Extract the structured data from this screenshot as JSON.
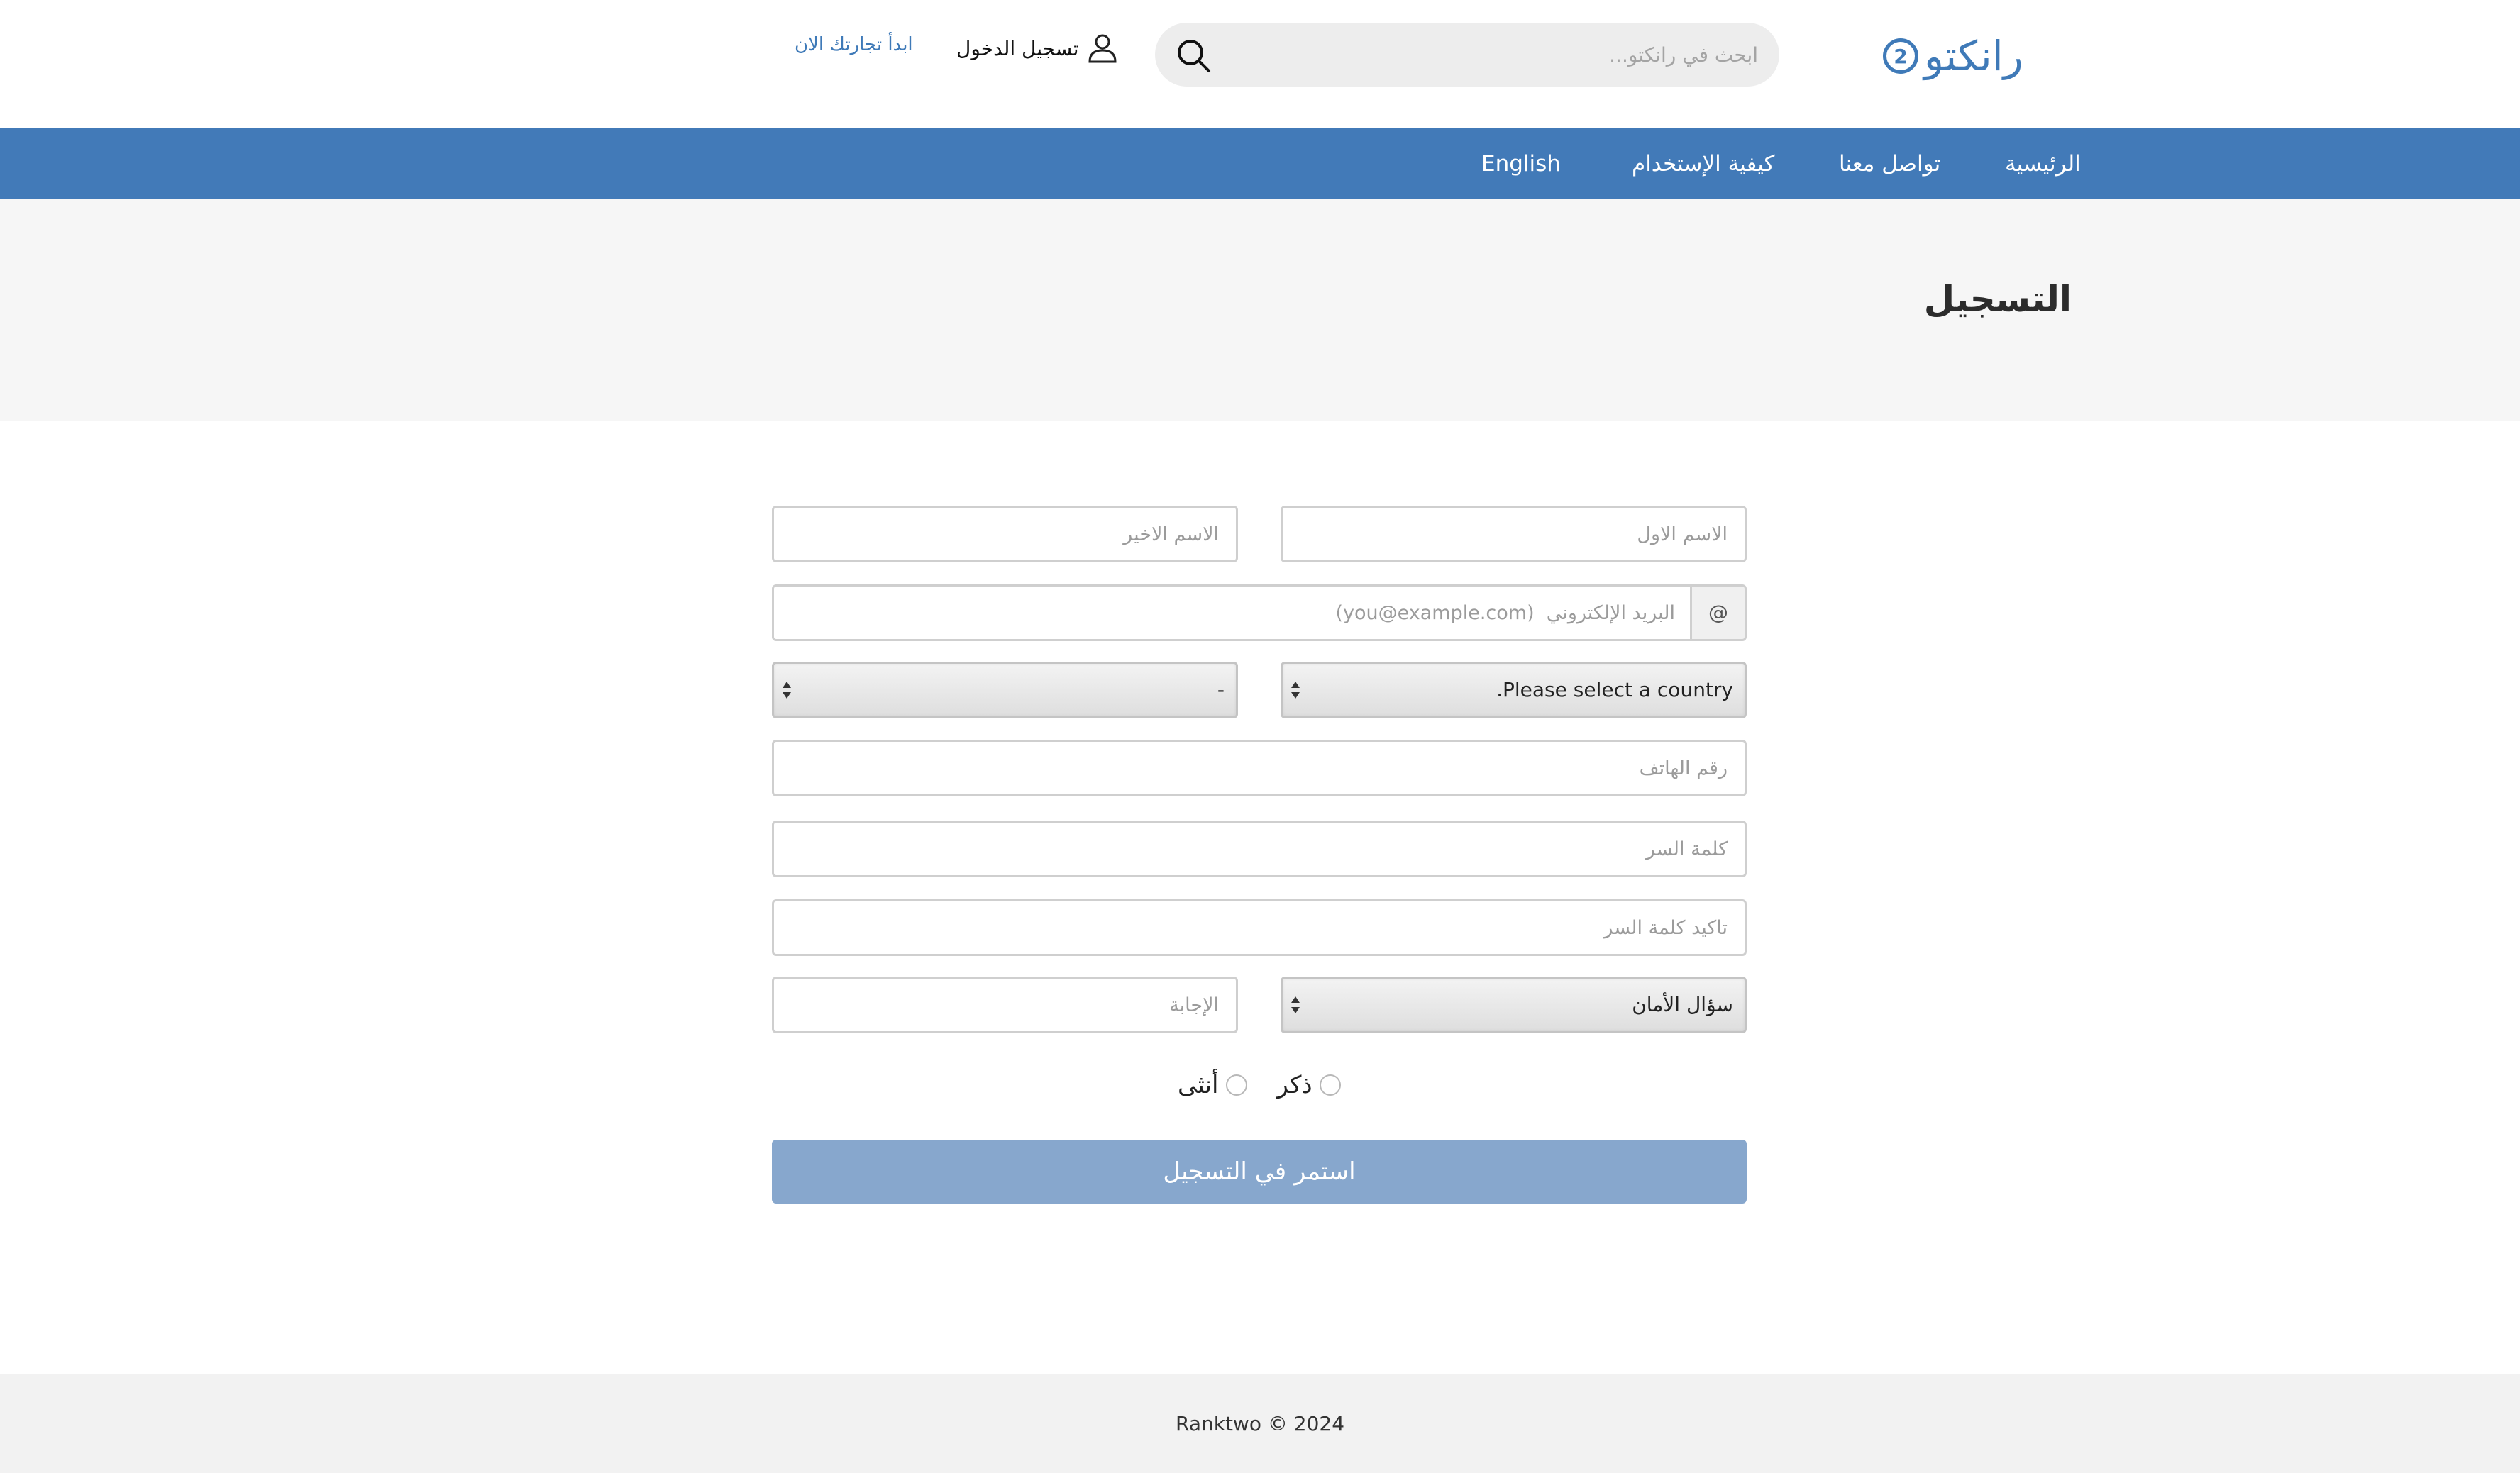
{
  "header": {
    "logo_text": "رانكتو",
    "logo_badge": "2",
    "search_placeholder": "ابحث في رانكتو...",
    "login_label": "تسجيل الدخول",
    "start_label": "ابدأ تجارتك الان"
  },
  "nav": {
    "items": [
      {
        "label": "الرئيسية"
      },
      {
        "label": "تواصل معنا"
      },
      {
        "label": "كيفية الإستخدام"
      },
      {
        "label": "English"
      }
    ]
  },
  "page": {
    "title": "التسجيل"
  },
  "form": {
    "first_name_placeholder": "الاسم الاول",
    "last_name_placeholder": "الاسم الاخير",
    "email_addon": "@",
    "email_placeholder": "البريد الإلكتروني  (you@example.com)",
    "country_select": "Please select a country.",
    "region_select": "-",
    "phone_placeholder": "رقم الهاتف",
    "password_placeholder": "كلمة السر",
    "confirm_password_placeholder": "تاكيد كلمة السر",
    "security_question_select": "سؤال الأمان",
    "answer_placeholder": "الإجابة",
    "gender_male": "ذكر",
    "gender_female": "أنثى",
    "submit_label": "استمر في التسجيل"
  },
  "footer": {
    "copyright": "Ranktwo © 2024"
  },
  "colors": {
    "brand": "#427ab8",
    "submit": "#87a7cd"
  }
}
